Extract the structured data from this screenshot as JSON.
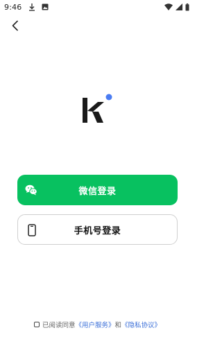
{
  "status_bar": {
    "time": "9:46",
    "icons": [
      "download-icon",
      "image-icon",
      "wifi-icon",
      "signal-icon",
      "battery-icon"
    ]
  },
  "nav": {
    "back_icon": "chevron-left-icon"
  },
  "logo": {
    "brand_color": "#1a1a1a",
    "dot_color": "#4a7cf2"
  },
  "buttons": {
    "wechat_login": {
      "label": "微信登录",
      "icon": "wechat-icon",
      "color": "#08c160"
    },
    "phone_login": {
      "label": "手机号登录",
      "icon": "phone-icon"
    }
  },
  "agreement": {
    "prefix": "已阅读同意",
    "user_service": "《用户服务》",
    "conjunction": "和",
    "privacy": "《隐私协议》",
    "checked": false,
    "link_color": "#3b6fd8"
  }
}
